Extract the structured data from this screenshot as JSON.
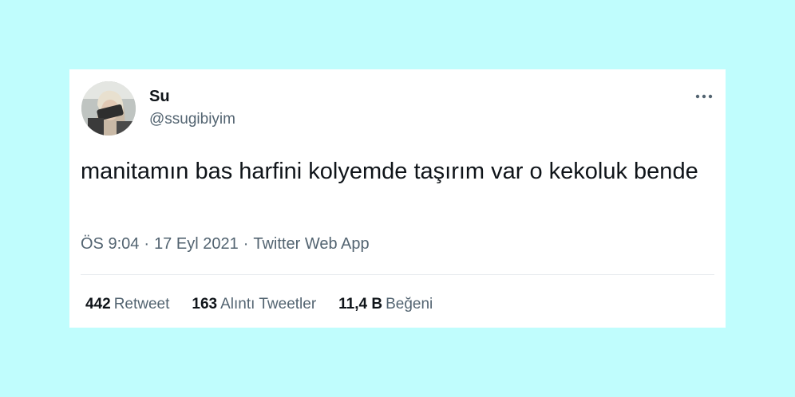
{
  "tweet": {
    "author": {
      "display_name": "Su",
      "handle": "@ssugibiyim"
    },
    "text": "manitamın bas harfini kolyemde taşırım var o kekoluk bende",
    "time": "ÖS 9:04",
    "date": "17 Eyl 2021",
    "separator": "·",
    "source": "Twitter Web App",
    "stats": {
      "retweets": {
        "count": "442",
        "label": "Retweet"
      },
      "quotes": {
        "count": "163",
        "label": "Alıntı Tweetler"
      },
      "likes": {
        "count": "11,4 B",
        "label": "Beğeni"
      }
    }
  },
  "icons": {
    "more": "more-horizontal-icon",
    "avatar": "profile-photo"
  },
  "colors": {
    "background": "#c0fdfd",
    "card": "#ffffff",
    "text_primary": "#0f1419",
    "text_secondary": "#536471"
  }
}
